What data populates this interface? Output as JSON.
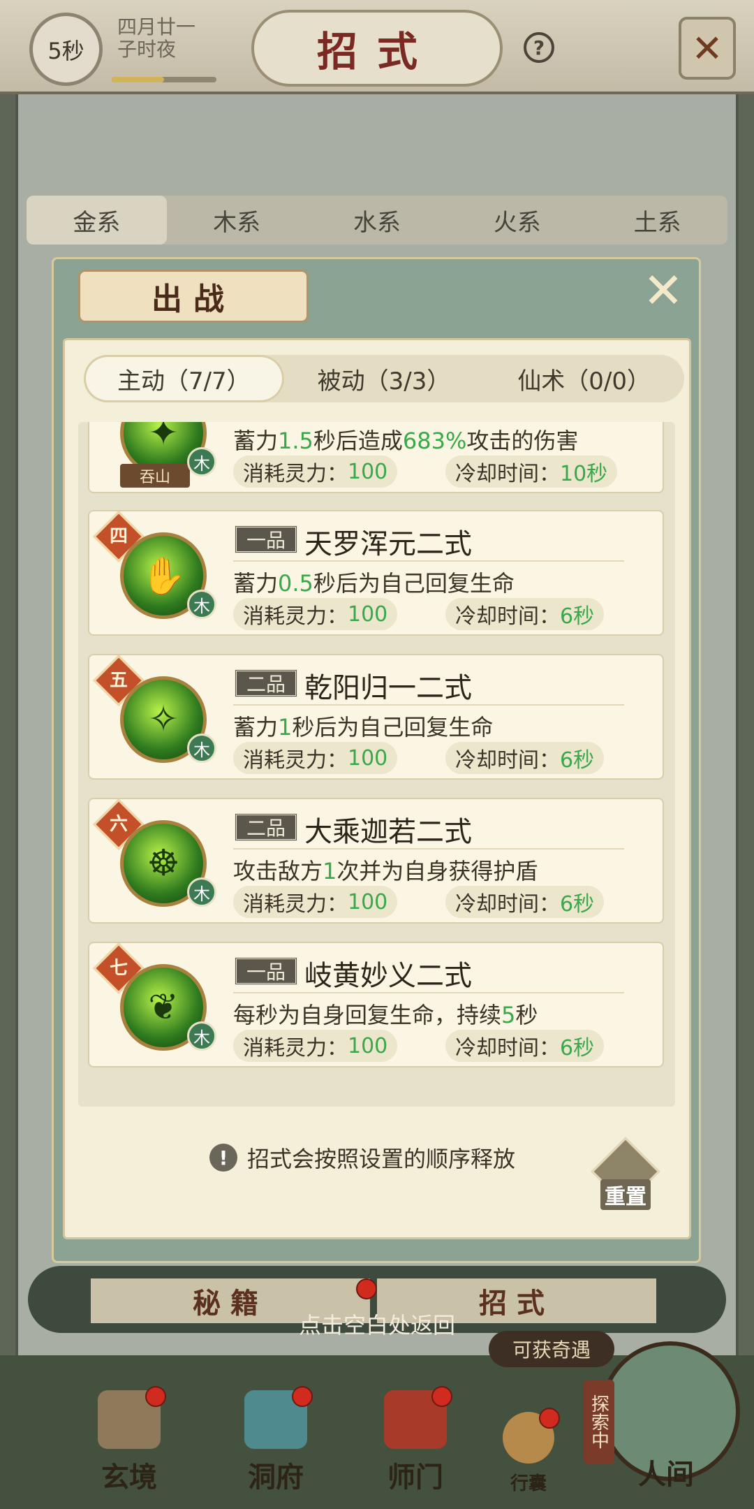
{
  "status": {
    "timer": "5秒",
    "date_line1": "四月廿一",
    "date_line2": "子时夜",
    "time_progress": 0.5
  },
  "page_title": "招式",
  "help_label": "?",
  "element_tabs": [
    "金系",
    "木系",
    "水系",
    "火系",
    "土系"
  ],
  "modal": {
    "title": "出战",
    "tabs": [
      "主动（7/7）",
      "被动（3/3）",
      "仙术（0/0）"
    ],
    "skills": [
      {
        "num": "",
        "grade": "",
        "name": "",
        "tag": "吞山",
        "element": "木",
        "desc_parts": [
          "蓄力",
          "1.5",
          "秒后造成",
          "683%",
          "攻击的伤害"
        ],
        "cost_label": "消耗灵力：",
        "cost": "100",
        "cd_label": "冷却时间：",
        "cd": "10秒"
      },
      {
        "num": "四",
        "grade": "一品",
        "name": "天罗浑元二式",
        "element": "木",
        "desc_parts": [
          "蓄力",
          "0.5",
          "秒后为自己回复生命",
          "",
          ""
        ],
        "cost_label": "消耗灵力：",
        "cost": "100",
        "cd_label": "冷却时间：",
        "cd": "6秒"
      },
      {
        "num": "五",
        "grade": "二品",
        "name": "乾阳归一二式",
        "element": "木",
        "desc_parts": [
          "蓄力",
          "1",
          "秒后为自己回复生命",
          "",
          ""
        ],
        "cost_label": "消耗灵力：",
        "cost": "100",
        "cd_label": "冷却时间：",
        "cd": "6秒"
      },
      {
        "num": "六",
        "grade": "二品",
        "name": "大乘迦若二式",
        "element": "木",
        "desc_parts": [
          "攻击敌方",
          "1",
          "次并为自身获得护盾",
          "",
          ""
        ],
        "cost_label": "消耗灵力：",
        "cost": "100",
        "cd_label": "冷却时间：",
        "cd": "6秒"
      },
      {
        "num": "七",
        "grade": "一品",
        "name": "岐黄妙义二式",
        "element": "木",
        "desc_parts": [
          "每秒为自身回复生命，持续",
          "5",
          "秒",
          "",
          ""
        ],
        "cost_label": "消耗灵力：",
        "cost": "100",
        "cd_label": "冷却时间：",
        "cd": "6秒"
      }
    ],
    "notice": "招式会按照设置的顺序释放",
    "reset_label": "重置"
  },
  "bottom_tabs": [
    "秘籍",
    "招式"
  ],
  "return_hint": "点击空白处返回",
  "adventure_badge": "可获奇遇",
  "explore_tag": "探索中",
  "nav": [
    "玄境",
    "洞府",
    "师门",
    "行囊",
    "人间"
  ],
  "colors": {
    "accent_green": "#3aa84a",
    "badge_red": "#c4502a",
    "title_red": "#7a2a22"
  }
}
